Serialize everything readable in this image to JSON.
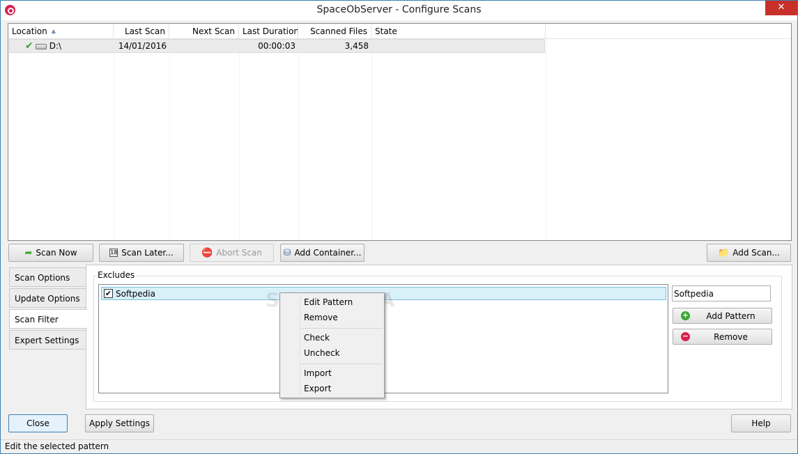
{
  "window": {
    "title": "SpaceObServer - Configure Scans",
    "close_glyph": "✕"
  },
  "scan_list": {
    "columns": [
      "Location",
      "Last Scan",
      "Next Scan",
      "Last Duration",
      "Scanned Files",
      "State"
    ],
    "rows": [
      {
        "location": "D:\\",
        "last_scan": "14/01/2016",
        "next_scan": "",
        "last_duration": "00:00:03",
        "scanned_files": "3,458",
        "state": ""
      }
    ]
  },
  "toolbar": {
    "scan_now": "Scan Now",
    "scan_later": "Scan Later...",
    "abort_scan": "Abort Scan",
    "add_container": "Add Container...",
    "add_scan": "Add Scan..."
  },
  "tabs": [
    "Scan Options",
    "Update Options",
    "Scan Filter",
    "Expert Settings"
  ],
  "active_tab": "Scan Filter",
  "scan_filter": {
    "group_label": "Excludes",
    "patterns": [
      {
        "text": "Softpedia",
        "checked": true
      }
    ],
    "pattern_input_value": "Softpedia",
    "add_pattern": "Add Pattern",
    "remove": "Remove"
  },
  "context_menu": {
    "items": [
      "Edit Pattern",
      "Remove",
      "Check",
      "Uncheck",
      "Import",
      "Export"
    ]
  },
  "watermark": "SOFTPEDIA",
  "footer": {
    "close": "Close",
    "apply_settings": "Apply Settings",
    "help": "Help"
  },
  "status": "Edit the selected pattern",
  "colors": {
    "accent": "#3c7fb1",
    "selection": "#d8f0f8",
    "title_close": "#c7312a"
  }
}
